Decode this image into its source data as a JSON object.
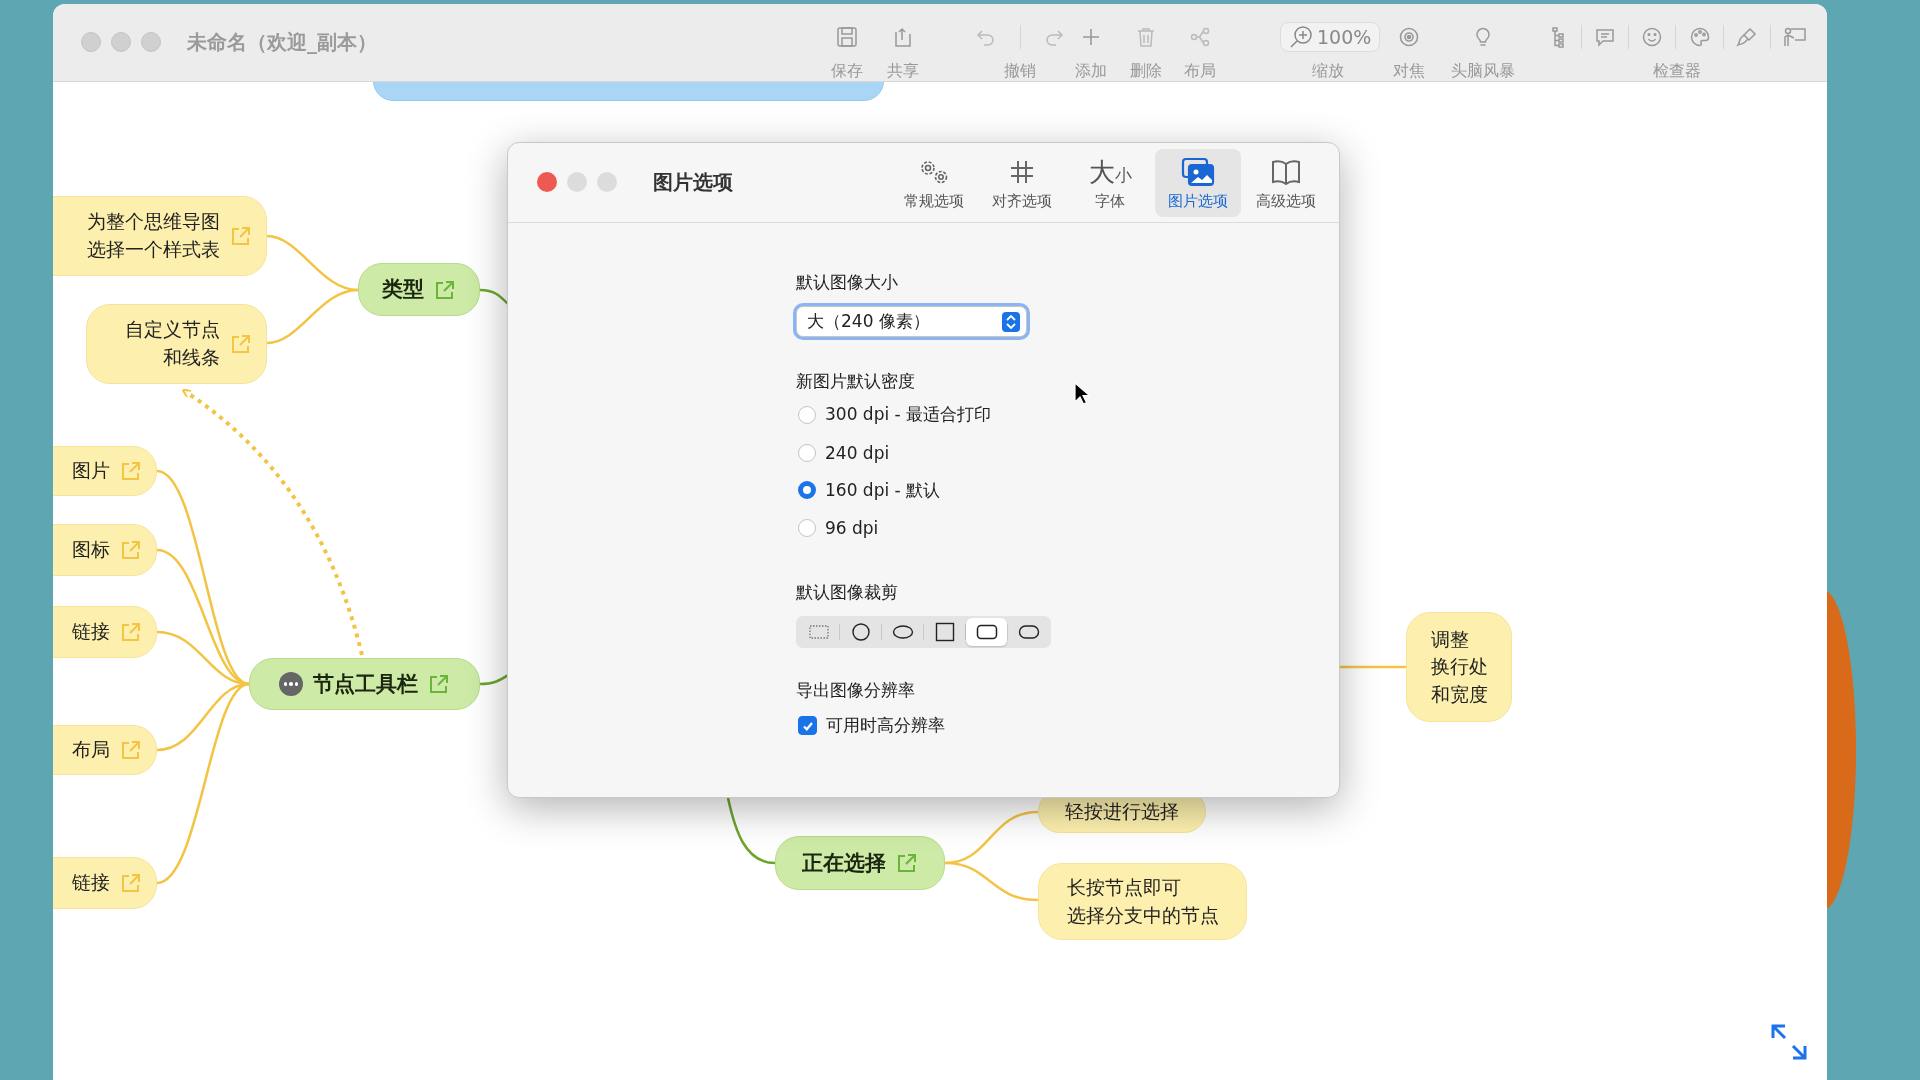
{
  "window": {
    "title": "未命名（欢迎_副本）"
  },
  "toolbar": {
    "items": [
      {
        "label": "保存"
      },
      {
        "label": "共享"
      },
      {
        "label": "撤销"
      },
      {
        "label": "添加"
      },
      {
        "label": "删除"
      },
      {
        "label": "布局"
      },
      {
        "label": "缩放",
        "reading": "100%"
      },
      {
        "label": "对焦"
      },
      {
        "label": "头脑风暴"
      },
      {
        "label": "检查器"
      }
    ]
  },
  "mind_map": {
    "nodes": [
      {
        "kind": "subtopic",
        "text": "为整个思维导图",
        "text_2": "选择一个样式表"
      },
      {
        "kind": "subtopic",
        "text": "自定义节点",
        "text_2": "和线条"
      },
      {
        "kind": "topic",
        "text": "类型"
      },
      {
        "kind": "subtopic",
        "text": "图片"
      },
      {
        "kind": "subtopic",
        "text": "图标"
      },
      {
        "kind": "subtopic",
        "text": "链接"
      },
      {
        "kind": "topic",
        "text": "节点工具栏"
      },
      {
        "kind": "subtopic",
        "text": "布局"
      },
      {
        "kind": "subtopic",
        "text": "链接"
      },
      {
        "kind": "subtopic",
        "text": "调整",
        "text_2": "换行处",
        "text_3": "和宽度"
      },
      {
        "kind": "subtopic",
        "text": "轻按进行选择"
      },
      {
        "kind": "topic",
        "text": "正在选择"
      },
      {
        "kind": "subtopic",
        "text": "长按节点即可",
        "text_2": "选择分支中的节点"
      }
    ]
  },
  "dialog": {
    "title": "图片选项",
    "tabs": [
      {
        "label": "常规选项",
        "selected": false
      },
      {
        "label": "对齐选项",
        "selected": false
      },
      {
        "label": "字体",
        "selected": false,
        "glyph": "大",
        "glyph_small": "小"
      },
      {
        "label": "图片选项",
        "selected": true
      },
      {
        "label": "高级选项",
        "selected": false
      }
    ],
    "image_size": {
      "label": "默认图像大小",
      "value": "大（240 像素）"
    },
    "density": {
      "label": "新图片默认密度",
      "options": [
        {
          "label": "300 dpi - 最适合打印",
          "selected": false
        },
        {
          "label": "240 dpi",
          "selected": false
        },
        {
          "label": "160 dpi - 默认",
          "selected": true
        },
        {
          "label": "96 dpi",
          "selected": false
        }
      ]
    },
    "crop": {
      "label": "默认图像裁剪",
      "options": [
        {
          "selected": false
        },
        {
          "selected": false
        },
        {
          "selected": false
        },
        {
          "selected": false
        },
        {
          "selected": true
        },
        {
          "selected": false
        }
      ]
    },
    "export": {
      "label": "导出图像分辨率",
      "checkbox": {
        "label": "可用时高分辨率",
        "checked": true
      }
    }
  }
}
